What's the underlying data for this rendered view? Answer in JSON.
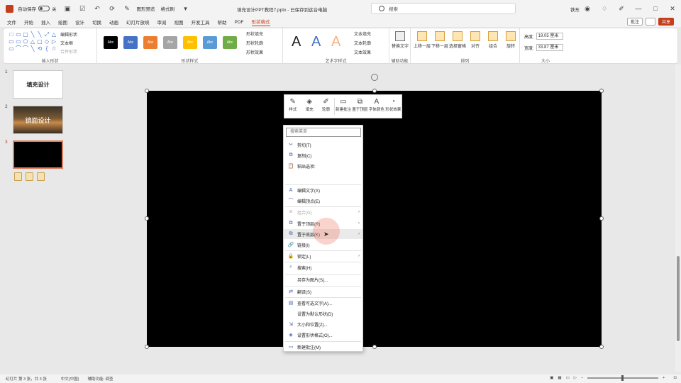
{
  "titlebar": {
    "autosave_label": "自动保存",
    "autosave_state": "关",
    "quick_tools": "图形预览",
    "format_painter": "格式刷",
    "doc_title": "填充设计PPT教程7.pptx - 已保存到这台电脑",
    "search_placeholder": "搜索",
    "user": "铁东"
  },
  "menu": {
    "tabs": [
      "文件",
      "开始",
      "插入",
      "绘图",
      "设计",
      "切换",
      "动画",
      "幻灯片放映",
      "审阅",
      "视图",
      "开发工具",
      "帮助",
      "PDF",
      "形状格式"
    ],
    "active_index": 13,
    "comment_button": "批注",
    "share_button": "共享"
  },
  "ribbon": {
    "insert_shapes": {
      "label": "插入形状",
      "edit_shape": "编辑形状",
      "text_box": "文本框",
      "merge_shapes": "合并形状",
      "shape_glyphs": [
        "□",
        "▭",
        "▢",
        "╲",
        "╲",
        "⤢",
        "△",
        "▭",
        "▭",
        "⬠",
        "△",
        "▢",
        "◇",
        "▷",
        "▭",
        "⌒",
        "⌒",
        "╲",
        "⟲",
        "{",
        "☆"
      ]
    },
    "shape_styles": {
      "label": "形状样式",
      "swatches": [
        {
          "text": "Abc",
          "color": "#000000"
        },
        {
          "text": "Abc",
          "color": "#4472c4"
        },
        {
          "text": "Abc",
          "color": "#ed7d31"
        },
        {
          "text": "Abc",
          "color": "#a5a5a5"
        },
        {
          "text": "Abc",
          "color": "#ffc000"
        },
        {
          "text": "Abc",
          "color": "#5b9bd5"
        },
        {
          "text": "Abc",
          "color": "#70ad47"
        }
      ],
      "fill": "形状填充",
      "outline": "形状轮廓",
      "effects": "形状效果"
    },
    "wordart": {
      "label": "艺术字样式",
      "samples": [
        {
          "text": "A",
          "color": "#222222"
        },
        {
          "text": "A",
          "color": "#4472c4"
        },
        {
          "text": "A",
          "color": "#f4b183"
        }
      ],
      "text_fill": "文本填充",
      "text_outline": "文本轮廓",
      "text_effects": "文本效果"
    },
    "accessibility": {
      "label": "辅助功能",
      "alt_text": "替换文字"
    },
    "arrange": {
      "label": "排列",
      "buttons": [
        "上移一层",
        "下移一层",
        "选择窗格",
        "对齐",
        "组合",
        "旋转"
      ]
    },
    "size": {
      "label": "大小",
      "height_label": "高度:",
      "height": "19.05 厘米",
      "width_label": "宽度:",
      "width": "33.87 厘米"
    }
  },
  "slides": [
    {
      "num": "1",
      "title": "填充设计"
    },
    {
      "num": "2",
      "title": "镜面设计"
    },
    {
      "num": "3",
      "title": ""
    }
  ],
  "minitoolbar": [
    {
      "label": "样式",
      "icon": "✎"
    },
    {
      "label": "填充",
      "icon": "◈"
    },
    {
      "label": "轮廓",
      "icon": "✐"
    },
    {
      "label": "新建批注",
      "icon": "▭"
    },
    {
      "label": "置于顶层",
      "icon": "⧉"
    },
    {
      "label": "字体颜色",
      "icon": "A"
    },
    {
      "label": "形状效果",
      "icon": "◔"
    }
  ],
  "contextmenu": {
    "search_placeholder": "搜索菜单",
    "items": [
      {
        "label": "剪切(T)",
        "icon": "✂"
      },
      {
        "label": "复制(C)",
        "icon": "⧉"
      },
      {
        "label": "粘贴选项:",
        "icon": "📋"
      },
      {
        "label": "编辑文字(X)",
        "icon": "A"
      },
      {
        "label": "编辑顶点(E)",
        "icon": "⌒"
      },
      {
        "label": "组合(G)",
        "icon": "⧈"
      },
      {
        "label": "置于顶层(R)",
        "icon": "⧉"
      },
      {
        "label": "置于底层(K)",
        "icon": "⧉"
      },
      {
        "label": "链接(I)",
        "icon": "🔗"
      },
      {
        "label": "锁定(L)",
        "icon": "🔒"
      },
      {
        "label": "搜索(H)",
        "icon": "⌕"
      },
      {
        "label": "另存为图片(S)...",
        "icon": ""
      },
      {
        "label": "翻译(S)",
        "icon": "⇄"
      },
      {
        "label": "查看可选文字(A)...",
        "icon": "▤"
      },
      {
        "label": "设置为默认形状(D)",
        "icon": ""
      },
      {
        "label": "大小和位置(Z)...",
        "icon": "⇲"
      },
      {
        "label": "设置形状格式(O)...",
        "icon": "◈"
      },
      {
        "label": "新建批注(M)",
        "icon": "▭"
      }
    ]
  },
  "statusbar": {
    "slide_info": "幻灯片 第 3 张，共 3 张",
    "language": "中文(中国)",
    "accessibility": "辅助功能: 调查",
    "zoom": "",
    "view_buttons": [
      "▣",
      "▦",
      "▭",
      "▷"
    ]
  },
  "colors": {
    "accent": "#c43e1c",
    "selection": "#e07c5e"
  }
}
